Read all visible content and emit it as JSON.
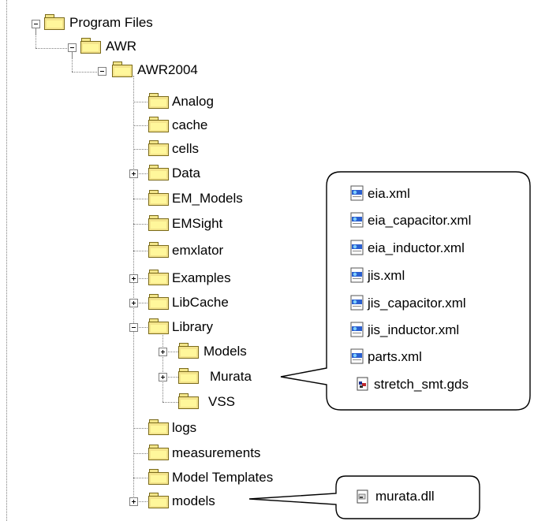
{
  "tree": {
    "program_files": "Program Files",
    "awr": "AWR",
    "awr2004": "AWR2004",
    "children": [
      {
        "label": "Analog",
        "expander": "none"
      },
      {
        "label": "cache",
        "expander": "none"
      },
      {
        "label": "cells",
        "expander": "none"
      },
      {
        "label": "Data",
        "expander": "plus"
      },
      {
        "label": "EM_Models",
        "expander": "none"
      },
      {
        "label": "EMSight",
        "expander": "none"
      },
      {
        "label": "emxlator",
        "expander": "none"
      },
      {
        "label": "Examples",
        "expander": "plus"
      },
      {
        "label": "LibCache",
        "expander": "plus"
      },
      {
        "label": "Library",
        "expander": "minus"
      },
      {
        "label": "Models",
        "expander": "plus"
      },
      {
        "label": "Murata",
        "expander": "plus"
      },
      {
        "label": "VSS",
        "expander": "none"
      },
      {
        "label": "logs",
        "expander": "none"
      },
      {
        "label": "measurements",
        "expander": "none"
      },
      {
        "label": "Model Templates",
        "expander": "none"
      },
      {
        "label": "models",
        "expander": "plus"
      }
    ]
  },
  "callout_murata": {
    "files": [
      {
        "name": "eia.xml",
        "icon": "xml-file-icon"
      },
      {
        "name": "eia_capacitor.xml",
        "icon": "xml-file-icon"
      },
      {
        "name": "eia_inductor.xml",
        "icon": "xml-file-icon"
      },
      {
        "name": "jis.xml",
        "icon": "xml-file-icon"
      },
      {
        "name": "jis_capacitor.xml",
        "icon": "xml-file-icon"
      },
      {
        "name": "jis_inductor.xml",
        "icon": "xml-file-icon"
      },
      {
        "name": "parts.xml",
        "icon": "xml-file-icon"
      },
      {
        "name": "stretch_smt.gds",
        "icon": "gds-file-icon"
      }
    ]
  },
  "callout_models": {
    "files": [
      {
        "name": "murata.dll",
        "icon": "dll-file-icon"
      }
    ]
  }
}
